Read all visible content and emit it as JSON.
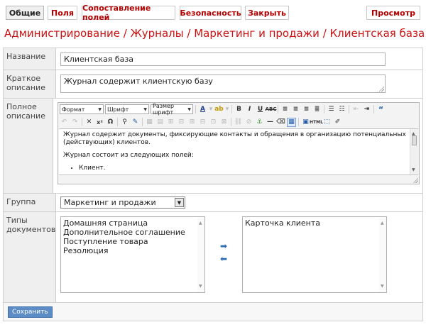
{
  "tabs": [
    {
      "label": "Общие"
    },
    {
      "label": "Поля"
    },
    {
      "label": "Сопоставление полей"
    },
    {
      "label": "Безопасность"
    },
    {
      "label": "Закрыть"
    },
    {
      "label": "Просмотр"
    }
  ],
  "breadcrumb": "Администрирование / Журналы / Маркетинг и продажи / Клиентская база",
  "form": {
    "name_label": "Название",
    "name_value": "Клиентская база",
    "short_label": "Краткое описание",
    "short_value": "Журнал содержит клиентскую базу",
    "full_label": "Полное описание",
    "group_label": "Группа",
    "group_value": "Маркетинг и продажи",
    "doctypes_label": "Типы документов"
  },
  "editor": {
    "format_label": "Формат",
    "font_label": "Шрифт",
    "size_label": "Размер шрифт",
    "paragraph1": "Журнал содержит документы, фиксирующие контакты и обращения в организацию потенциальных (действующих) клиентов.",
    "paragraph2": "Журнал состоит из следующих полей:",
    "bullet1": "Клиент."
  },
  "available_types": [
    "Домашняя страница",
    "Дополнительное соглашение",
    "Поступление товара",
    "Резолюция"
  ],
  "selected_types": [
    "Карточка клиента"
  ],
  "footer": {
    "save_label": "Сохранить"
  },
  "colors": {
    "accent": "#cc1010",
    "save_button": "#5b8cc6"
  }
}
